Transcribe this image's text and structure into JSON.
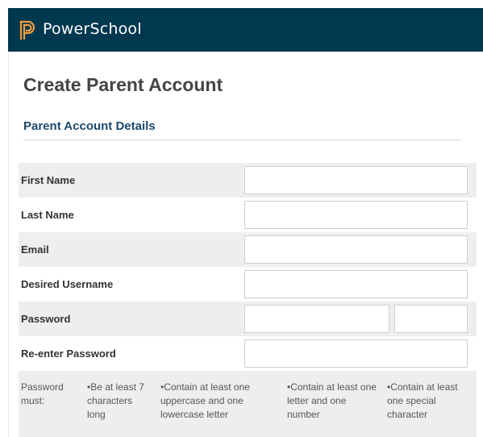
{
  "header": {
    "brand": "PowerSchool",
    "brand_color": "#00384f"
  },
  "page": {
    "title": "Create Parent Account",
    "section_title": "Parent Account Details"
  },
  "form": {
    "fields": [
      {
        "label": "First Name",
        "value": ""
      },
      {
        "label": "Last Name",
        "value": ""
      },
      {
        "label": "Email",
        "value": ""
      },
      {
        "label": "Desired Username",
        "value": ""
      },
      {
        "label": "Password",
        "value": ""
      },
      {
        "label": "Re-enter Password",
        "value": ""
      }
    ],
    "password_rules": {
      "intro": "Password must:",
      "items": [
        "•Be at least 7 characters long",
        "•Contain at least one uppercase and one lowercase letter",
        "•Contain at least one letter and one number",
        "•Contain at least one special character"
      ]
    }
  }
}
